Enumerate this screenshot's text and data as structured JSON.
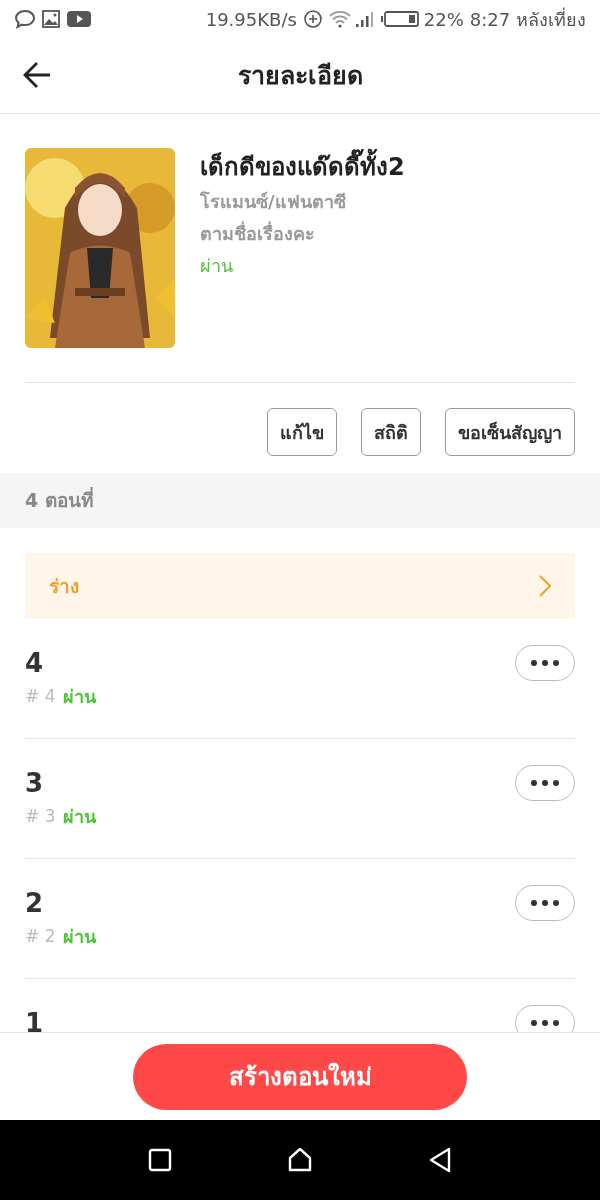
{
  "status_bar": {
    "speed": "19.95KB/s",
    "battery": "22%",
    "time": "8:27 หลังเที่ยง"
  },
  "header": {
    "title": "รายละเอียด"
  },
  "book": {
    "title": "เด็กดีของแด๊ดดี๊ทั้ง2",
    "genre": "โรแมนซ์/แฟนตาซี",
    "note": "ตามชื่อเรื่องคะ",
    "status": "ผ่าน"
  },
  "actions": [
    "แก้ไข",
    "สถิติ",
    "ขอเซ็นสัญญา"
  ],
  "episode_count": "4 ตอนที่",
  "draft": {
    "label": "ร่าง"
  },
  "episodes": [
    {
      "title": "4",
      "number": "# 4",
      "status": "ผ่าน"
    },
    {
      "title": "3",
      "number": "# 3",
      "status": "ผ่าน"
    },
    {
      "title": "2",
      "number": "# 2",
      "status": "ผ่าน"
    },
    {
      "title": "1"
    }
  ],
  "create_button": "สร้างตอนใหม่"
}
